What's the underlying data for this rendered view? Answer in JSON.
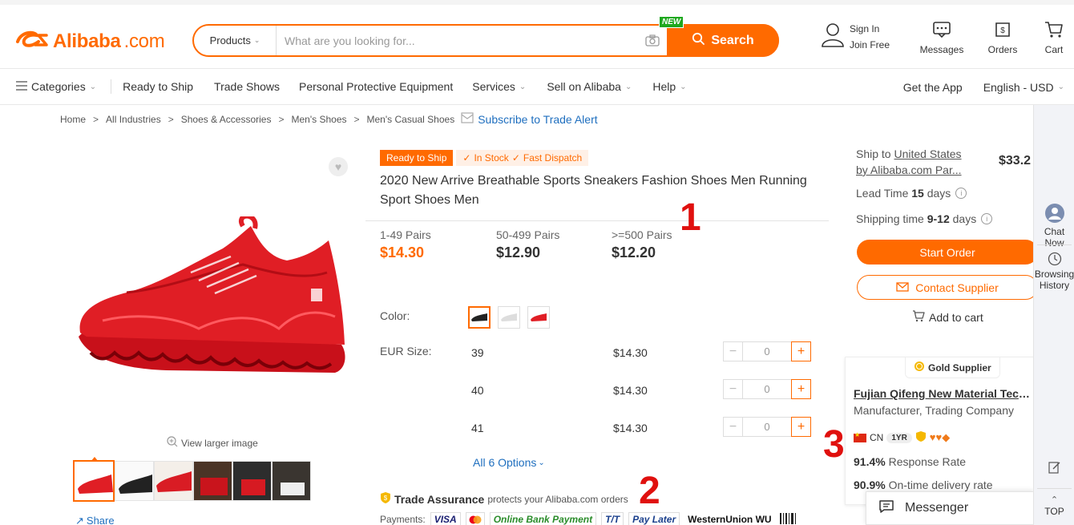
{
  "header": {
    "logo_text": "Alibaba",
    "logo_suffix": ".com",
    "search_category": "Products",
    "search_placeholder": "What are you looking for...",
    "new_badge": "NEW",
    "search_button": "Search",
    "sign_in": "Sign In",
    "join_free": "Join Free",
    "messages": "Messages",
    "orders": "Orders",
    "cart": "Cart"
  },
  "nav": {
    "categories": "Categories",
    "items": [
      "Ready to Ship",
      "Trade Shows",
      "Personal Protective Equipment",
      "Services",
      "Sell on Alibaba",
      "Help"
    ],
    "get_app": "Get the App",
    "language": "English - USD"
  },
  "breadcrumb": {
    "items": [
      "Home",
      "All Industries",
      "Shoes & Accessories",
      "Men's Shoes",
      "Men's Casual Shoes"
    ],
    "separator": ">",
    "subscribe": "Subscribe to Trade Alert"
  },
  "gallery": {
    "view_larger": "View larger image",
    "share": "Share"
  },
  "product": {
    "tag_ready": "Ready to Ship",
    "tag_stock": "In Stock",
    "tag_dispatch": "Fast Dispatch",
    "title": "2020 New Arrive Breathable Sports Sneakers Fashion Shoes Men Running Sport Shoes Men",
    "tiers": [
      {
        "qty": "1-49 Pairs",
        "price": "$14.30"
      },
      {
        "qty": "50-499 Pairs",
        "price": "$12.90"
      },
      {
        "qty": ">=500 Pairs",
        "price": "$12.20"
      }
    ],
    "color_label": "Color:",
    "size_label": "EUR Size:",
    "sizes": [
      {
        "size": "39",
        "price": "$14.30",
        "qty": "0"
      },
      {
        "size": "40",
        "price": "$14.30",
        "qty": "0"
      },
      {
        "size": "41",
        "price": "$14.30",
        "qty": "0"
      }
    ],
    "all_options": "All 6 Options",
    "trade_assurance": "Trade Assurance",
    "trade_assurance_desc": "protects your Alibaba.com orders",
    "payments_label": "Payments:",
    "payments": [
      "VISA",
      "Online Bank Payment",
      "T/T",
      "Pay Later",
      "WesternUnion WU"
    ]
  },
  "annotations": [
    "1",
    "2",
    "3"
  ],
  "order": {
    "ship_to_prefix": "Ship to",
    "ship_country": "United States",
    "ship_by": "by Alibaba.com Par...",
    "ship_price": "$33.2",
    "lead_time_label": "Lead Time",
    "lead_time_value": "15",
    "lead_time_unit": "days",
    "shipping_time_label": "Shipping time",
    "shipping_time_value": "9-12",
    "shipping_time_unit": "days",
    "start_order": "Start Order",
    "contact_supplier": "Contact Supplier",
    "add_to_cart": "Add to cart"
  },
  "supplier": {
    "badge": "Gold Supplier",
    "name": "Fujian Qifeng New Material Techn...",
    "type": "Manufacturer, Trading Company",
    "country": "CN",
    "years": "1YR",
    "response_rate_value": "91.4%",
    "response_rate_label": "Response Rate",
    "ontime_value": "90.9%",
    "ontime_label": "On-time delivery rate"
  },
  "messenger": "Messenger",
  "rail": {
    "chat": "Chat Now",
    "history_1": "Browsing",
    "history_2": "History",
    "top": "TOP"
  },
  "colors": {
    "accent": "#ff6a00",
    "link": "#1f6fbf",
    "annotation": "#e0100e"
  }
}
